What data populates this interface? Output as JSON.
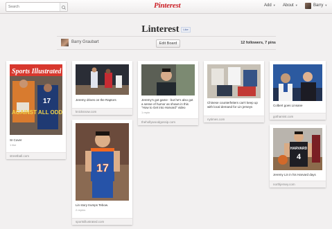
{
  "header": {
    "search_placeholder": "Search",
    "logo": "Pinterest",
    "nav": {
      "add": "Add",
      "about": "About",
      "user": "Barry"
    }
  },
  "board": {
    "title": "Linterest",
    "like_label": "Like",
    "owner": "Barry Graubart",
    "edit_label": "Edit Board",
    "followers": "12 followers, 7 pins"
  },
  "pins": [
    {
      "desc": "SI Cover",
      "meta": "1 like",
      "source": "streetball.com"
    },
    {
      "desc": "Jeremy drives on the Raptors",
      "meta": "",
      "source": "knicksnow.com"
    },
    {
      "desc": "Jeremy's got game - but he's also got a sense of humor as shown in this \"How to Get into Harvard\" video",
      "meta": "1 repin",
      "source": "thehollywoodgossip.com"
    },
    {
      "desc": "Chinese counterfeiters can't keep up with local demand for Lin jerseys",
      "meta": "",
      "source": "nytimes.com"
    },
    {
      "desc": "Colbert goes Linsane",
      "meta": "",
      "source": "gothamist.com"
    },
    {
      "desc": "Lin story trumps Tebow.",
      "meta": "2 repins",
      "source": "sportsillustrated.com"
    },
    {
      "desc": "Jeremy Lin in his Harvard days",
      "meta": "",
      "source": "northjersey.com"
    }
  ],
  "images": {
    "si_cover": {
      "masthead": "Sports Illustrated",
      "headline": "AGAINST ALL ODDS"
    },
    "knicks_jersey": {
      "number": "17"
    },
    "harvard_jersey": {
      "team": "HARVARD",
      "number": "4"
    }
  }
}
